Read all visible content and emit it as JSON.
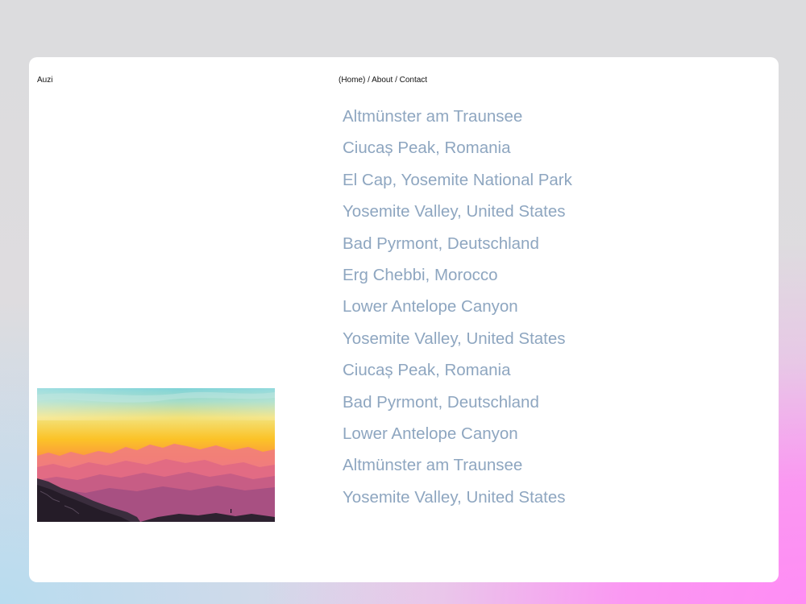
{
  "brand": {
    "name": "Auzi"
  },
  "nav": {
    "items": [
      {
        "label": "(Home)"
      },
      {
        "label": "About"
      },
      {
        "label": "Contact"
      }
    ],
    "separator": "/"
  },
  "places": [
    "Altmünster am Traunsee",
    "Ciucaș Peak, Romania",
    "El Cap, Yosemite National Park",
    "Yosemite Valley, United States",
    "Bad Pyrmont, Deutschland",
    "Erg Chebbi, Morocco",
    "Lower Antelope Canyon",
    "Yosemite Valley, United States",
    "Ciucaș Peak, Romania",
    "Bad Pyrmont, Deutschland",
    "Lower Antelope Canyon",
    "Altmünster am Traunsee",
    "Yosemite Valley, United States"
  ],
  "colors": {
    "link_text": "#8ea6c0",
    "card_background": "#ffffff"
  },
  "image": {
    "subject": "sunset-mountain-landscape"
  }
}
